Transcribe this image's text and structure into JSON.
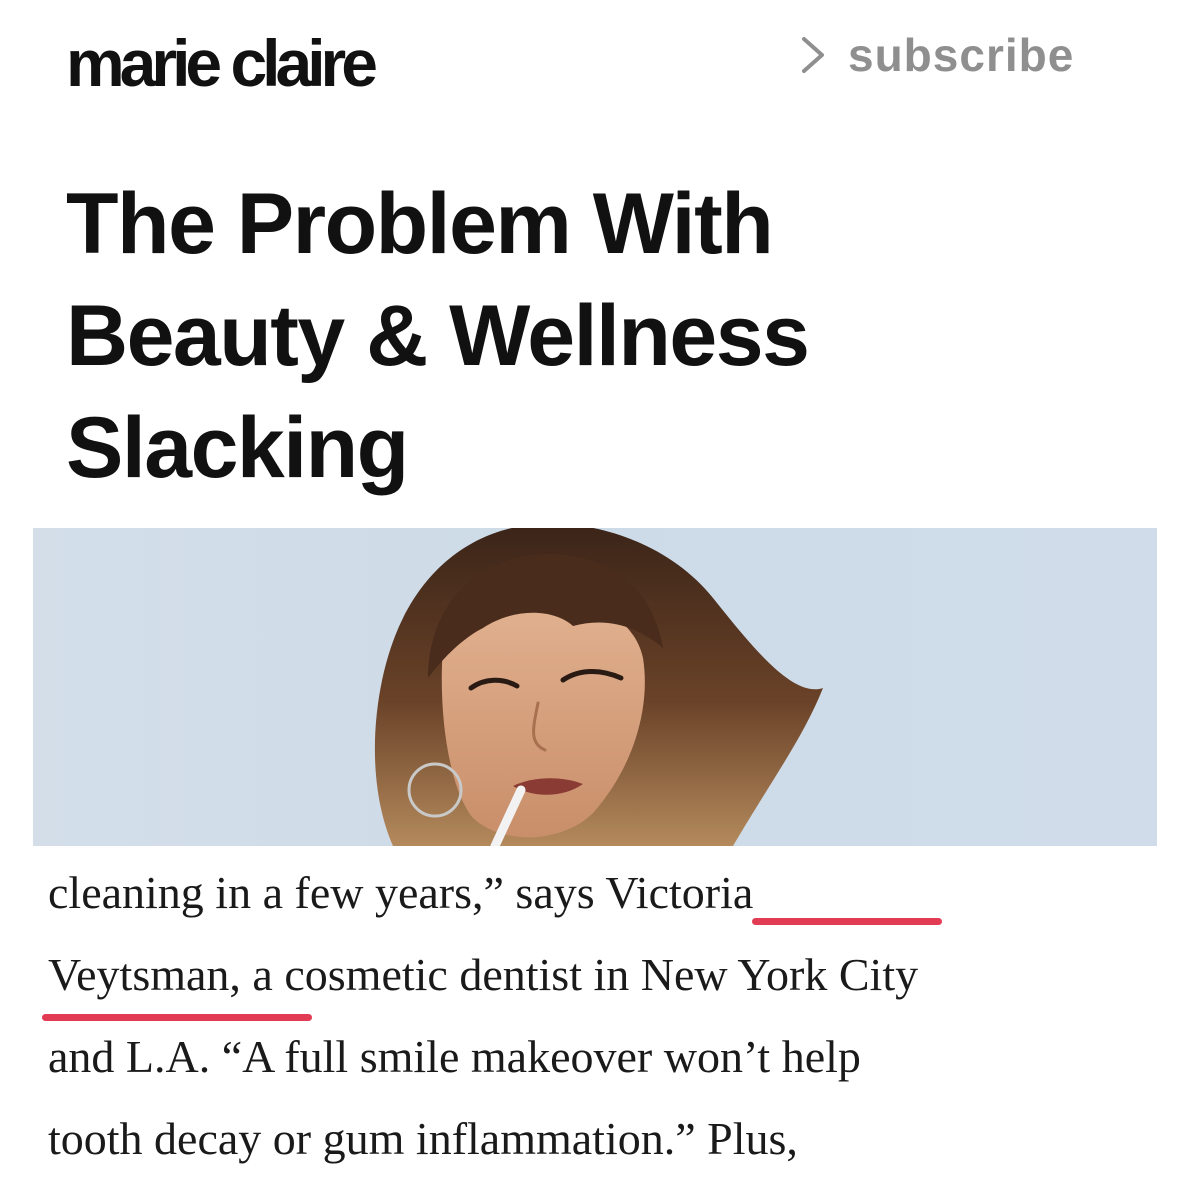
{
  "header": {
    "logo_text": "marie claire",
    "subscribe_label": "subscribe",
    "subscribe_icon": "chevron-right-icon"
  },
  "article": {
    "headline_lines": [
      "The Problem With",
      "Beauty & Wellness",
      "Slacking"
    ],
    "hero_image": "woman-with-bangs-holding-toothbrush-photo",
    "body": {
      "line1_prefix": "cleaning in a few years,” says ",
      "link_part1": "Victoria",
      "link_part2": "Veytsman,",
      "line2_suffix": " a cosmetic dentist in New York City",
      "line3": "and L.A. “A full smile makeover won’t help",
      "line4": "tooth decay or gum inflammation.” Plus,"
    }
  },
  "colors": {
    "logo": "#111111",
    "subscribe": "#8f8f8f",
    "headline": "#111111",
    "body_text": "#1a1a1a",
    "highlight_mark": "#e23b54",
    "hero_background": "#cfdbe7"
  }
}
